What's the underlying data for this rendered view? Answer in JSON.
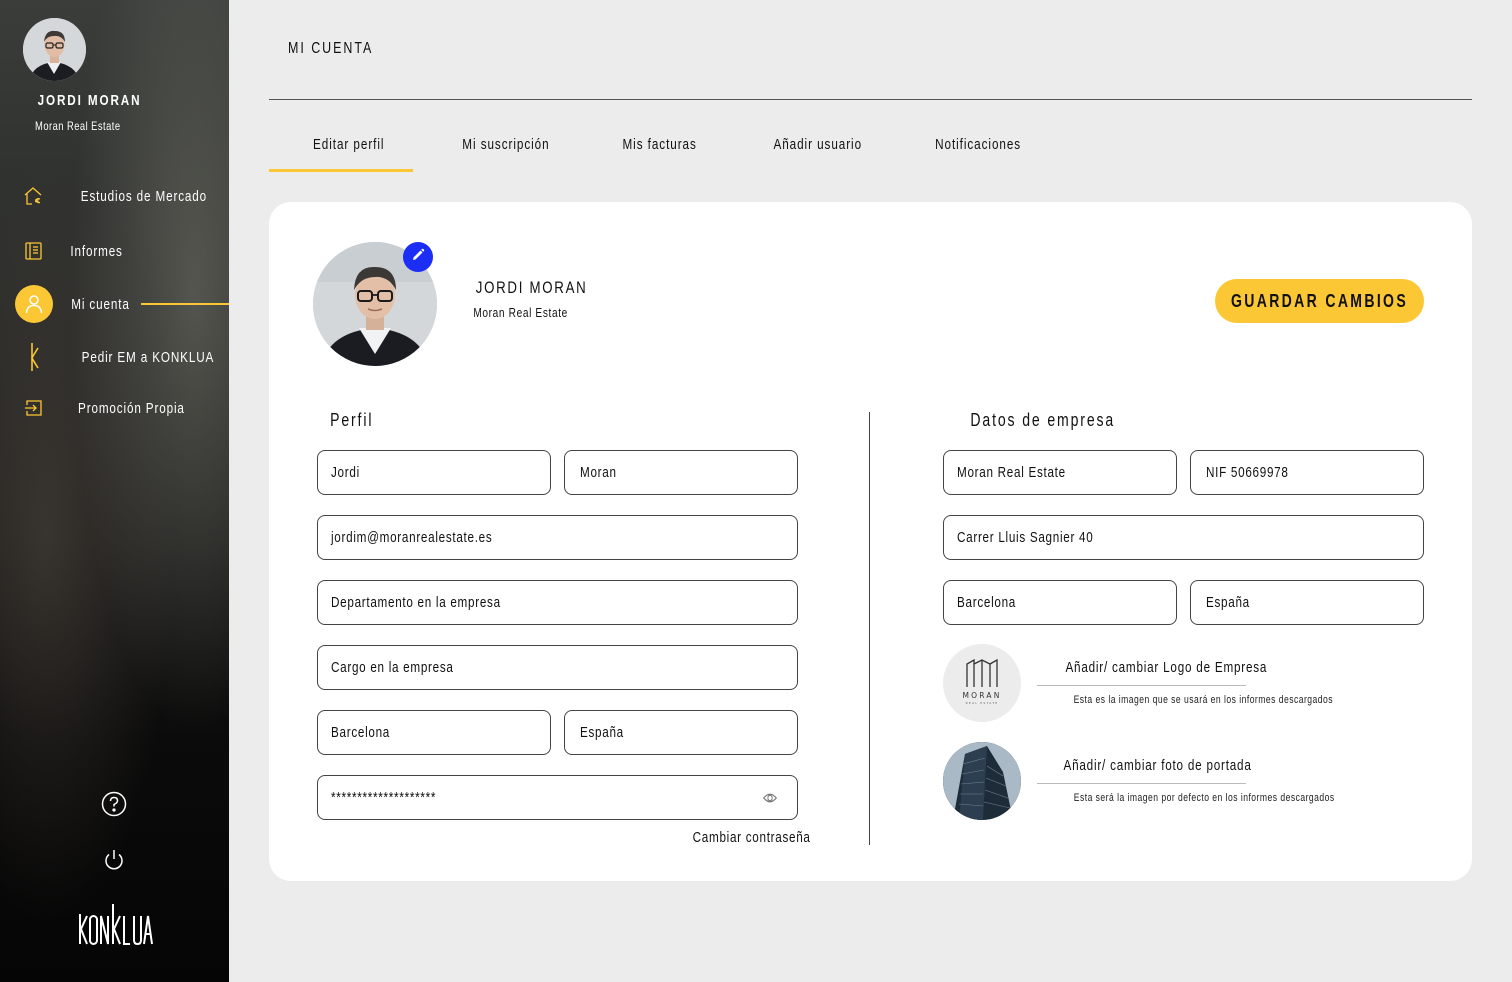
{
  "user": {
    "name": "JORDI MORAN",
    "company": "Moran Real Estate"
  },
  "sidebar": {
    "items": [
      {
        "label": "Estudios de Mercado",
        "icon": "house-euro-icon"
      },
      {
        "label": "Informes",
        "icon": "report-icon"
      },
      {
        "label": "Mi cuenta",
        "icon": "user-icon",
        "active": true
      },
      {
        "label": "Pedir EM a KONKLUA",
        "icon": "konklua-k-icon"
      },
      {
        "label": "Promoción Propia",
        "icon": "login-box-icon"
      }
    ],
    "logo": "KONKLUA"
  },
  "page": {
    "title": "MI CUENTA"
  },
  "tabs": [
    {
      "label": "Editar perfil",
      "active": true
    },
    {
      "label": "Mi suscripción"
    },
    {
      "label": "Mis facturas"
    },
    {
      "label": "Añadir usuario"
    },
    {
      "label": "Notificaciones"
    }
  ],
  "profile": {
    "name": "JORDI MORAN",
    "company": "Moran Real Estate",
    "save_label": "GUARDAR CAMBIOS"
  },
  "perfil": {
    "title": "Perfil",
    "first_name": "Jordi",
    "last_name": "Moran",
    "email": "jordim@moranrealestate.es",
    "department_placeholder": "Departamento en la empresa",
    "position_placeholder": "Cargo en la empresa",
    "city": "Barcelona",
    "country": "España",
    "password": "********************",
    "change_password": "Cambiar contraseña"
  },
  "empresa": {
    "title": "Datos de empresa",
    "name": "Moran Real Estate",
    "nif": "NIF 50669978",
    "address": "Carrer Lluis Sagnier 40",
    "city": "Barcelona",
    "country": "España",
    "logo_action": "Añadir/ cambiar Logo de Empresa",
    "logo_desc": "Esta es la imagen que se usará en los informes descargados",
    "logo_text": "MORAN",
    "logo_subtext": "REAL ESTATE",
    "cover_action": "Añadir/ cambiar foto de portada",
    "cover_desc": "Esta será la imagen por defecto en los informes descargados"
  },
  "colors": {
    "accent": "#fcc734",
    "edit": "#1c2ef5",
    "background": "#ececec"
  }
}
